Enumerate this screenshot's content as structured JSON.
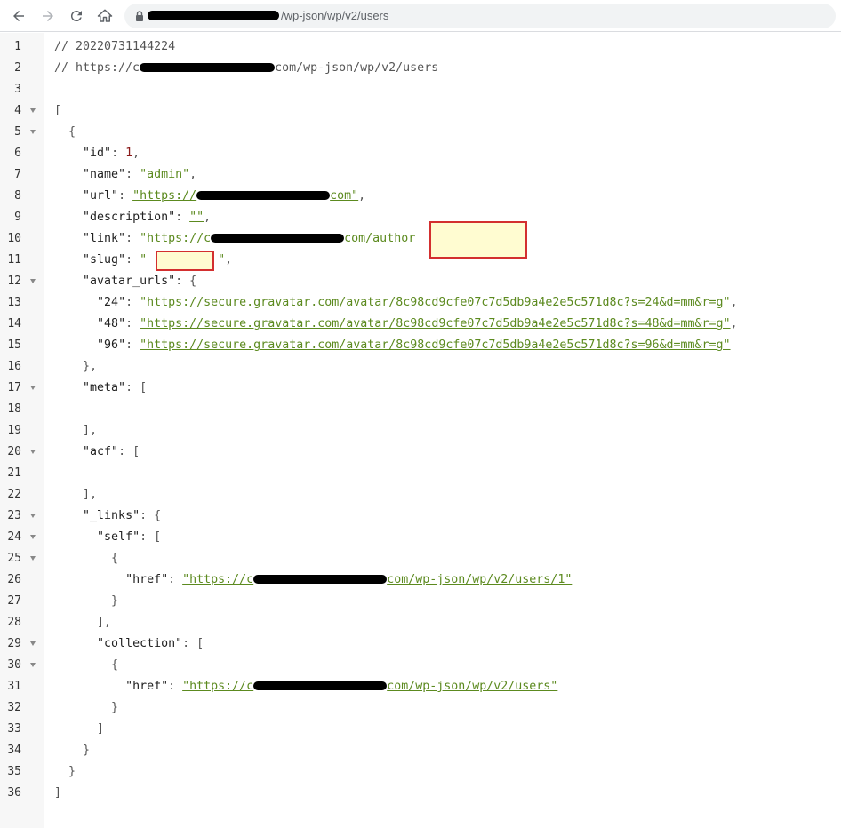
{
  "browser": {
    "url_suffix": "/wp-json/wp/v2/users"
  },
  "comments": {
    "timestamp": "// 20220731144224",
    "url_prefix": "// https://c",
    "url_suffix": "com/wp-json/wp/v2/users"
  },
  "json": {
    "id_key": "\"id\"",
    "id_value": "1",
    "name_key": "\"name\"",
    "name_value": "\"admin\"",
    "url_key": "\"url\"",
    "url_value_prefix": "\"https://",
    "url_value_suffix": "com\"",
    "description_key": "\"description\"",
    "description_value": "\"\"",
    "link_key": "\"link\"",
    "link_value_prefix": "\"https://c",
    "link_value_suffix": "com/author",
    "slug_key": "\"slug\"",
    "avatar_key": "\"avatar_urls\"",
    "avatar": [
      {
        "key": "\"24\"",
        "value": "\"https://secure.gravatar.com/avatar/8c98cd9cfe07c7d5db9a4e2e5c571d8c?s=24&d=mm&r=g\""
      },
      {
        "key": "\"48\"",
        "value": "\"https://secure.gravatar.com/avatar/8c98cd9cfe07c7d5db9a4e2e5c571d8c?s=48&d=mm&r=g\""
      },
      {
        "key": "\"96\"",
        "value": "\"https://secure.gravatar.com/avatar/8c98cd9cfe07c7d5db9a4e2e5c571d8c?s=96&d=mm&r=g\""
      }
    ],
    "meta_key": "\"meta\"",
    "acf_key": "\"acf\"",
    "links_key": "\"_links\"",
    "self_key": "\"self\"",
    "href_key": "\"href\"",
    "self_href_prefix": "\"https://c",
    "self_href_suffix": "com/wp-json/wp/v2/users/1\"",
    "collection_key": "\"collection\"",
    "collection_href_prefix": "\"https://c",
    "collection_href_suffix": "com/wp-json/wp/v2/users\""
  }
}
